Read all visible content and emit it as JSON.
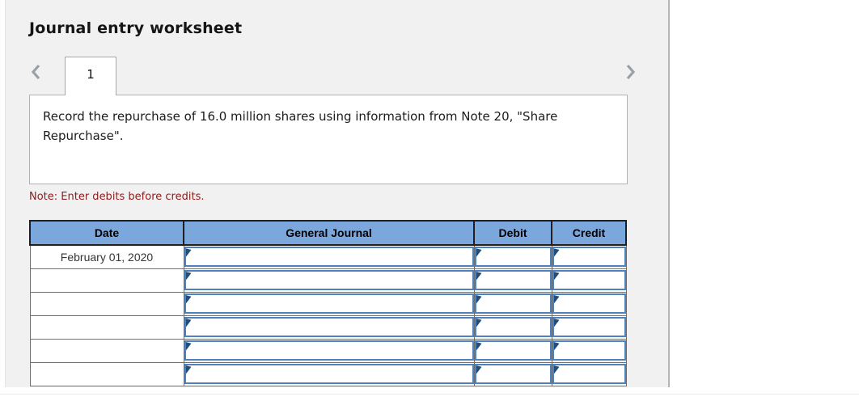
{
  "header": {
    "title": "Journal entry worksheet"
  },
  "pager": {
    "prev_icon": "chevron-left-icon",
    "next_icon": "chevron-right-icon",
    "tab_label": "1"
  },
  "instruction": {
    "text": "Record the repurchase of 16.0 million shares using information from Note 20, \"Share Repurchase\"."
  },
  "note": {
    "text": "Note: Enter debits before credits."
  },
  "table": {
    "headers": [
      "Date",
      "General Journal",
      "Debit",
      "Credit"
    ],
    "rows": [
      {
        "date": "February 01, 2020",
        "journal": "",
        "debit": "",
        "credit": ""
      },
      {
        "date": "",
        "journal": "",
        "debit": "",
        "credit": ""
      },
      {
        "date": "",
        "journal": "",
        "debit": "",
        "credit": ""
      },
      {
        "date": "",
        "journal": "",
        "debit": "",
        "credit": ""
      },
      {
        "date": "",
        "journal": "",
        "debit": "",
        "credit": ""
      },
      {
        "date": "",
        "journal": "",
        "debit": "",
        "credit": ""
      }
    ]
  },
  "colors": {
    "table_header_bg": "#7ba7dc",
    "input_cell_bg": "#7ba7dc",
    "input_border": "#4f81bd",
    "input_marker": "#1f4e7a",
    "note_text": "#8e1b1b",
    "panel_bg": "#f1f1f2"
  }
}
